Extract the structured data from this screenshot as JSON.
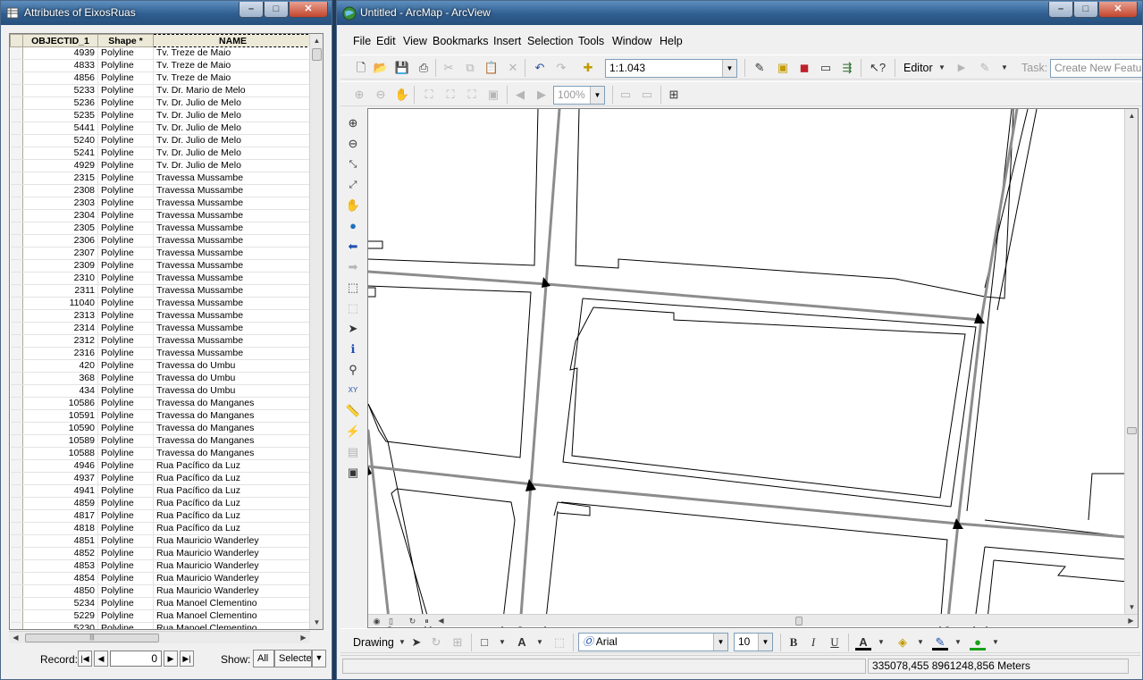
{
  "attribute_window": {
    "title": "Attributes of EixosRuas",
    "columns": [
      "OBJECTID_1",
      "Shape *",
      "NAME"
    ],
    "rows": [
      {
        "id": "4939",
        "shape": "Polyline",
        "name": "Tv. Treze de Maio"
      },
      {
        "id": "4833",
        "shape": "Polyline",
        "name": "Tv. Treze de Maio"
      },
      {
        "id": "4856",
        "shape": "Polyline",
        "name": "Tv. Treze de Maio"
      },
      {
        "id": "5233",
        "shape": "Polyline",
        "name": "Tv. Dr. Mario de Melo"
      },
      {
        "id": "5236",
        "shape": "Polyline",
        "name": "Tv. Dr. Julio de Melo"
      },
      {
        "id": "5235",
        "shape": "Polyline",
        "name": "Tv. Dr. Julio de Melo"
      },
      {
        "id": "5441",
        "shape": "Polyline",
        "name": "Tv. Dr. Julio de Melo"
      },
      {
        "id": "5240",
        "shape": "Polyline",
        "name": "Tv. Dr. Julio de Melo"
      },
      {
        "id": "5241",
        "shape": "Polyline",
        "name": "Tv. Dr. Julio de Melo"
      },
      {
        "id": "4929",
        "shape": "Polyline",
        "name": "Tv. Dr. Julio de Melo"
      },
      {
        "id": "2315",
        "shape": "Polyline",
        "name": "Travessa Mussambe"
      },
      {
        "id": "2308",
        "shape": "Polyline",
        "name": "Travessa Mussambe"
      },
      {
        "id": "2303",
        "shape": "Polyline",
        "name": "Travessa Mussambe"
      },
      {
        "id": "2304",
        "shape": "Polyline",
        "name": "Travessa Mussambe"
      },
      {
        "id": "2305",
        "shape": "Polyline",
        "name": "Travessa Mussambe"
      },
      {
        "id": "2306",
        "shape": "Polyline",
        "name": "Travessa Mussambe"
      },
      {
        "id": "2307",
        "shape": "Polyline",
        "name": "Travessa Mussambe"
      },
      {
        "id": "2309",
        "shape": "Polyline",
        "name": "Travessa Mussambe"
      },
      {
        "id": "2310",
        "shape": "Polyline",
        "name": "Travessa Mussambe"
      },
      {
        "id": "2311",
        "shape": "Polyline",
        "name": "Travessa Mussambe"
      },
      {
        "id": "11040",
        "shape": "Polyline",
        "name": "Travessa Mussambe"
      },
      {
        "id": "2313",
        "shape": "Polyline",
        "name": "Travessa Mussambe"
      },
      {
        "id": "2314",
        "shape": "Polyline",
        "name": "Travessa Mussambe"
      },
      {
        "id": "2312",
        "shape": "Polyline",
        "name": "Travessa Mussambe"
      },
      {
        "id": "2316",
        "shape": "Polyline",
        "name": "Travessa Mussambe"
      },
      {
        "id": "420",
        "shape": "Polyline",
        "name": "Travessa do Umbu"
      },
      {
        "id": "368",
        "shape": "Polyline",
        "name": "Travessa do Umbu"
      },
      {
        "id": "434",
        "shape": "Polyline",
        "name": "Travessa do Umbu"
      },
      {
        "id": "10586",
        "shape": "Polyline",
        "name": "Travessa do Manganes"
      },
      {
        "id": "10591",
        "shape": "Polyline",
        "name": "Travessa do Manganes"
      },
      {
        "id": "10590",
        "shape": "Polyline",
        "name": "Travessa do Manganes"
      },
      {
        "id": "10589",
        "shape": "Polyline",
        "name": "Travessa do Manganes"
      },
      {
        "id": "10588",
        "shape": "Polyline",
        "name": "Travessa do Manganes"
      },
      {
        "id": "4946",
        "shape": "Polyline",
        "name": "Rua Pacífico da Luz"
      },
      {
        "id": "4937",
        "shape": "Polyline",
        "name": "Rua Pacífico da Luz"
      },
      {
        "id": "4941",
        "shape": "Polyline",
        "name": "Rua Pacífico da Luz"
      },
      {
        "id": "4859",
        "shape": "Polyline",
        "name": "Rua Pacífico da Luz"
      },
      {
        "id": "4817",
        "shape": "Polyline",
        "name": "Rua Pacífico da Luz"
      },
      {
        "id": "4818",
        "shape": "Polyline",
        "name": "Rua Pacífico da Luz"
      },
      {
        "id": "4851",
        "shape": "Polyline",
        "name": "Rua Mauricio Wanderley"
      },
      {
        "id": "4852",
        "shape": "Polyline",
        "name": "Rua Mauricio Wanderley"
      },
      {
        "id": "4853",
        "shape": "Polyline",
        "name": "Rua Mauricio Wanderley"
      },
      {
        "id": "4854",
        "shape": "Polyline",
        "name": "Rua Mauricio Wanderley"
      },
      {
        "id": "4850",
        "shape": "Polyline",
        "name": "Rua Mauricio Wanderley"
      },
      {
        "id": "5234",
        "shape": "Polyline",
        "name": "Rua Manoel Clementino"
      },
      {
        "id": "5229",
        "shape": "Polyline",
        "name": "Rua Manoel Clementino"
      },
      {
        "id": "5230",
        "shape": "Polyline",
        "name": "Rua Manoel Clementino"
      }
    ],
    "record_label": "Record:",
    "record_value": "0",
    "show_label": "Show:",
    "show_all": "All",
    "show_selected": "Selected"
  },
  "arcmap": {
    "title": "Untitled - ArcMap - ArcView",
    "menu": [
      "File",
      "Edit",
      "View",
      "Bookmarks",
      "Insert",
      "Selection",
      "Tools",
      "Window",
      "Help"
    ],
    "scale": "1:1.043",
    "editor_label": "Editor",
    "task_label": "Task:",
    "task_value": "Create New Featu",
    "zoom_percent": "100%",
    "drawing_label": "Drawing",
    "font_name": "Arial",
    "font_size": "10",
    "bold": "B",
    "italic": "I",
    "underline": "U",
    "status_coords": "335078,455  8961248,856 Meters"
  },
  "colors": {
    "titlebar": "#2f5e90",
    "road": "#808080",
    "parcel": "#000000"
  }
}
